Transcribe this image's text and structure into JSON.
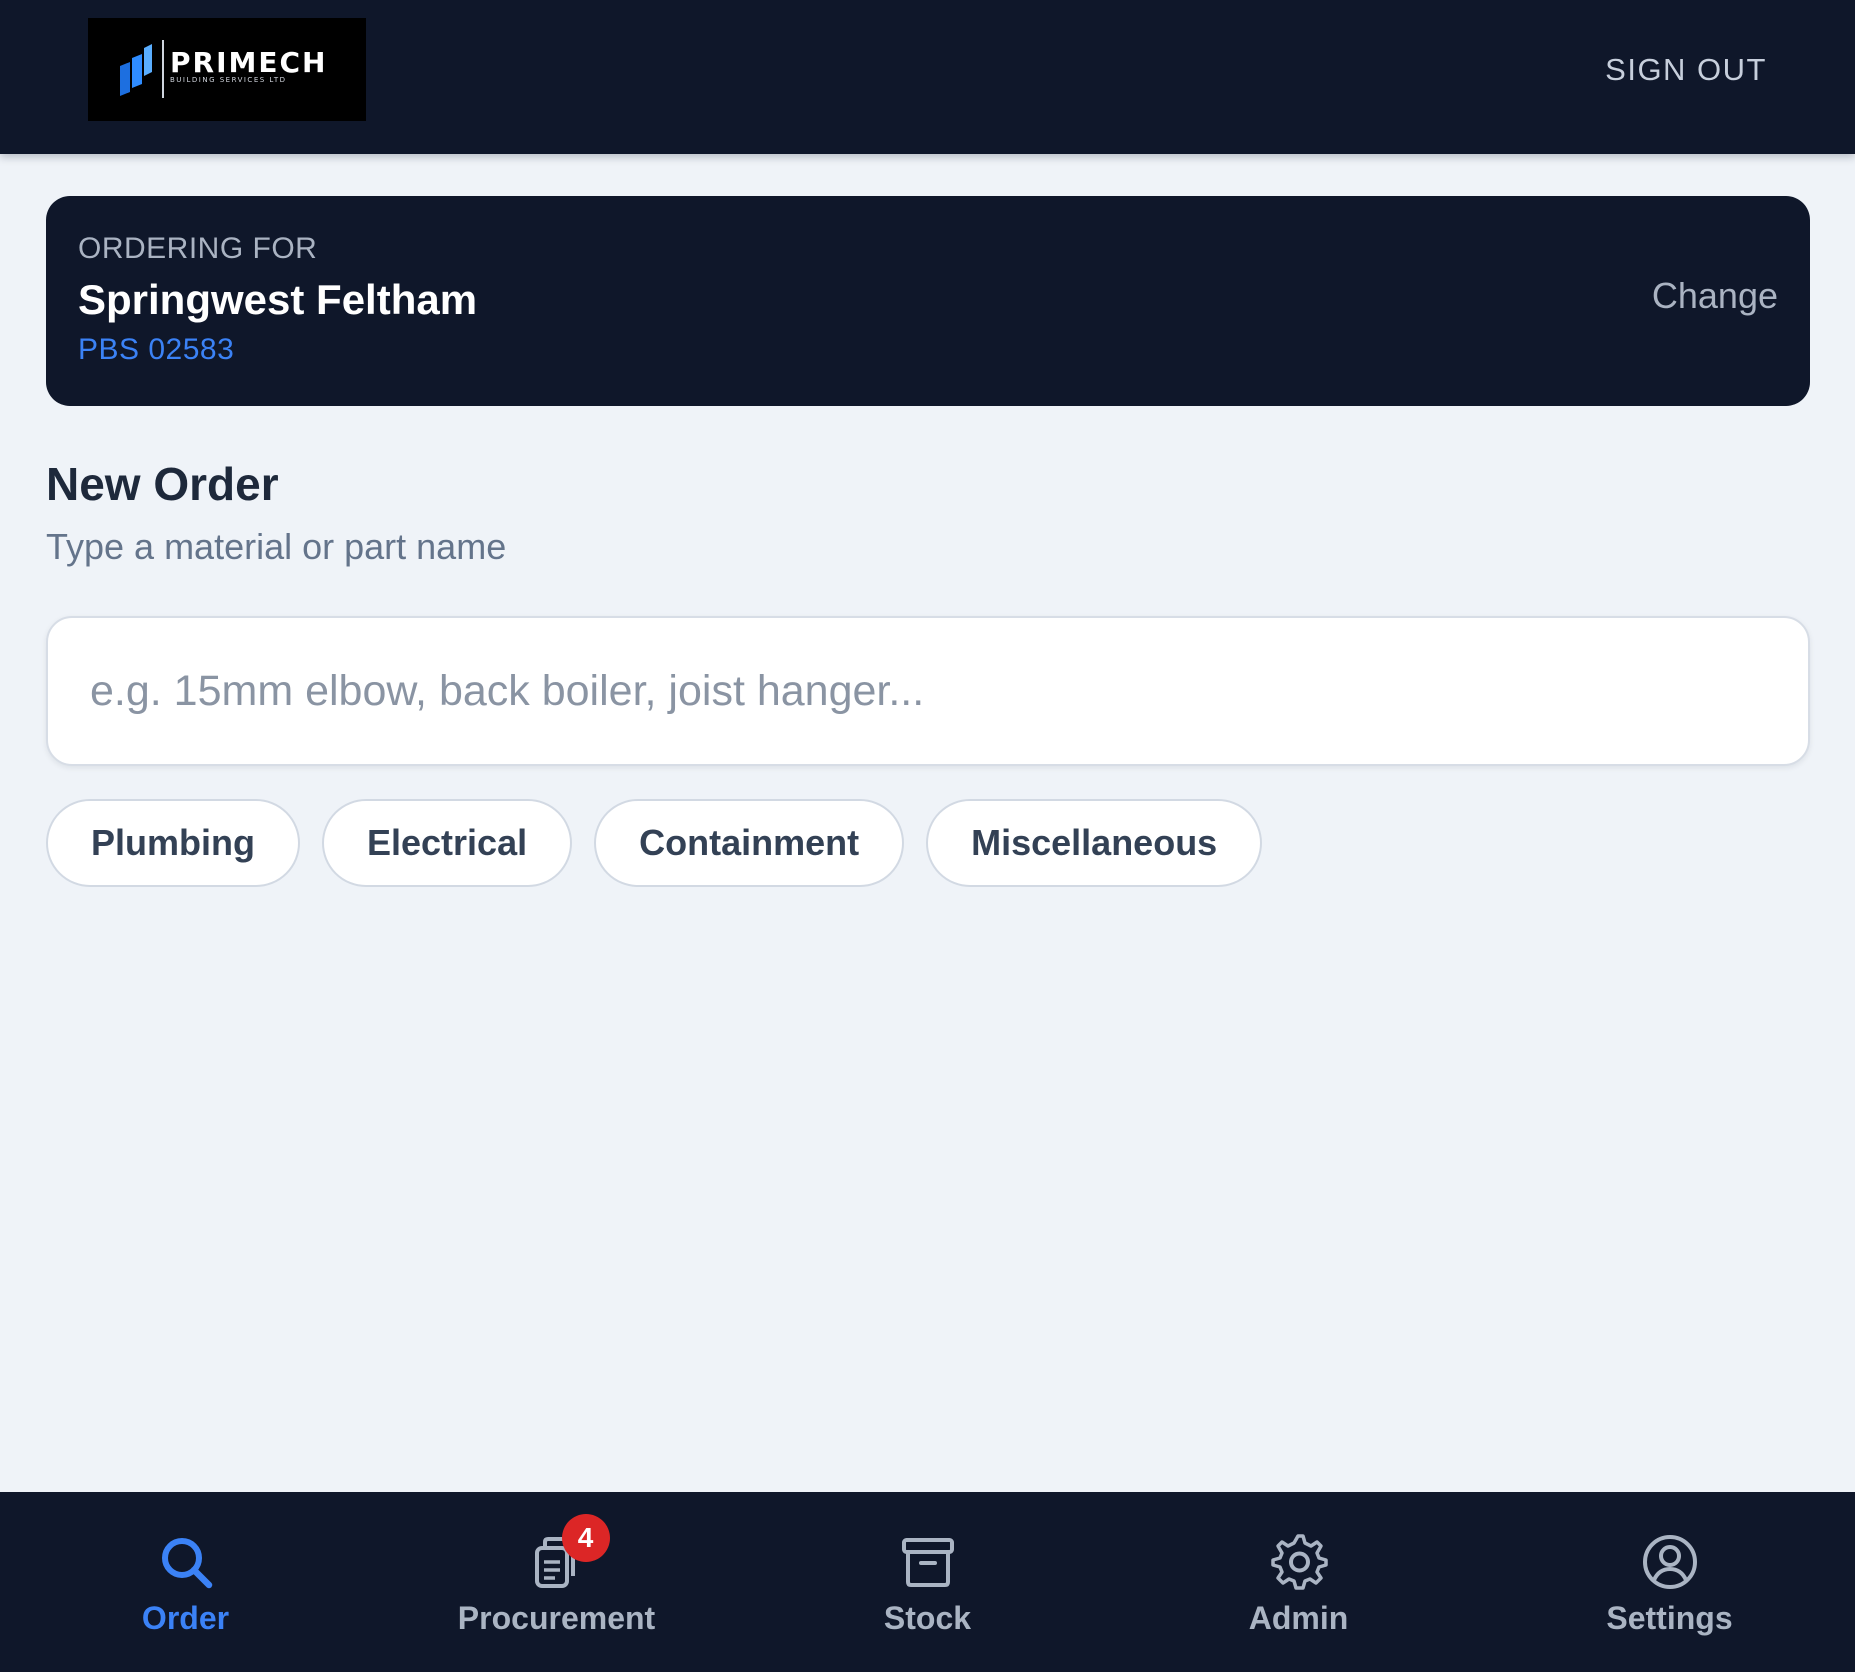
{
  "header": {
    "logo_text": "PRIMECH",
    "logo_subtext": "BUILDING SERVICES LTD",
    "sign_out_label": "SIGN OUT"
  },
  "site": {
    "eyebrow": "ORDERING FOR",
    "name": "Springwest Feltham",
    "code": "PBS 02583",
    "change_label": "Change"
  },
  "order": {
    "title": "New Order",
    "subtitle": "Type a material or part name",
    "search_placeholder": "e.g. 15mm elbow, back boiler, joist hanger...",
    "search_value": ""
  },
  "categories": [
    "Plumbing",
    "Electrical",
    "Containment",
    "Miscellaneous"
  ],
  "nav": {
    "items": [
      {
        "label": "Order",
        "icon": "search-icon",
        "active": true
      },
      {
        "label": "Procurement",
        "icon": "clipboard-icon",
        "badge": "4"
      },
      {
        "label": "Stock",
        "icon": "archive-box-icon"
      },
      {
        "label": "Admin",
        "icon": "gear-icon"
      },
      {
        "label": "Settings",
        "icon": "user-circle-icon"
      }
    ]
  },
  "colors": {
    "navy": "#0f172a",
    "accent": "#3b82f6",
    "badge": "#dc2626",
    "background": "#eff3f8"
  }
}
